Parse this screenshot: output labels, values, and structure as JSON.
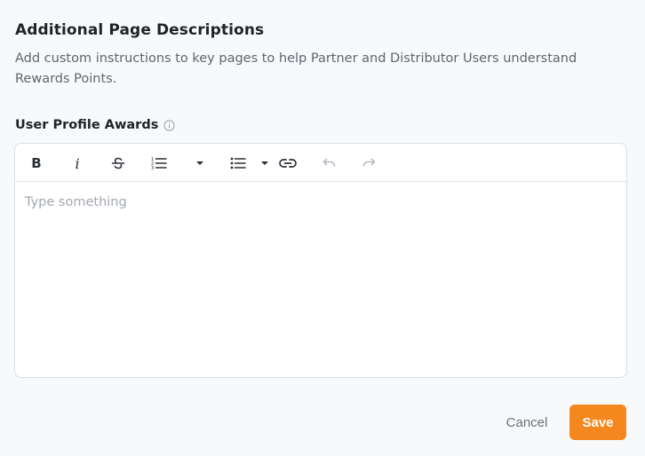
{
  "section": {
    "title": "Additional Page Descriptions",
    "description": "Add custom instructions to key pages to help Partner and Distributor Users understand Rewards Points."
  },
  "field": {
    "label": "User Profile Awards",
    "info_icon": "info-circle-icon"
  },
  "toolbar": {
    "bold_label": "B",
    "italic_label": "i",
    "items": [
      "bold-icon",
      "italic-icon",
      "strikethrough-icon",
      "ordered-list-icon",
      "chevron-down-icon",
      "bullet-list-icon",
      "chevron-down-icon",
      "link-icon",
      "undo-icon",
      "redo-icon"
    ]
  },
  "editor": {
    "value": "",
    "placeholder": "Type something"
  },
  "actions": {
    "cancel_label": "Cancel",
    "save_label": "Save"
  },
  "colors": {
    "accent": "#f5871f",
    "text_primary": "#1f2328",
    "text_secondary": "#5f6570",
    "border": "#dcdfe4"
  }
}
